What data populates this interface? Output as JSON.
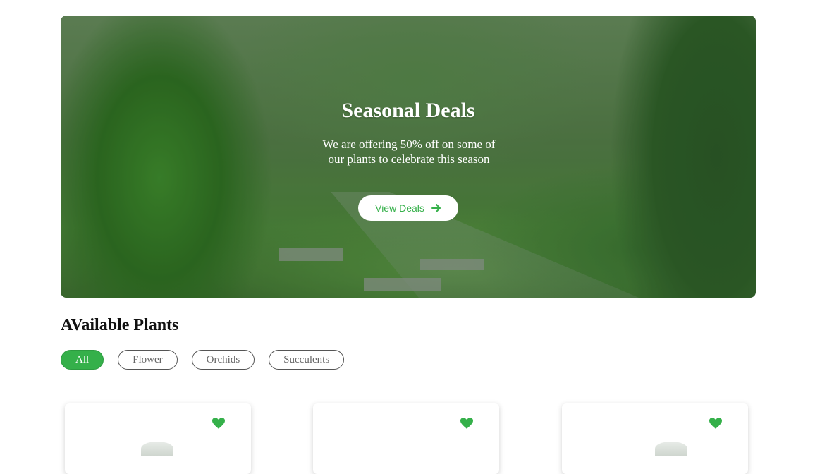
{
  "hero": {
    "title": "Seasonal Deals",
    "subtitle": "We are offering 50% off on some of our plants to celebrate this season",
    "button_label": "View Deals",
    "button_icon": "arrow-right-icon"
  },
  "plants": {
    "title": "AVailable Plants",
    "filters": [
      {
        "label": "All",
        "active": true
      },
      {
        "label": "Flower",
        "active": false
      },
      {
        "label": "Orchids",
        "active": false
      },
      {
        "label": "Succulents",
        "active": false
      }
    ],
    "cards": [
      {
        "favorite_icon": "heart-icon"
      },
      {
        "favorite_icon": "heart-icon"
      },
      {
        "favorite_icon": "heart-icon"
      }
    ]
  },
  "colors": {
    "accent": "#35b04a",
    "text_dark": "#111111",
    "chip_text": "#666666"
  }
}
